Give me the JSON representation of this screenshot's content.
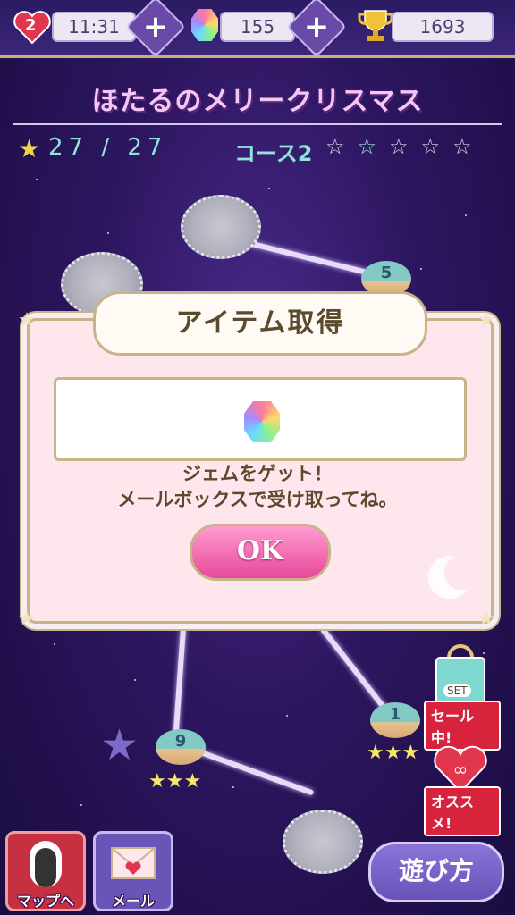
{
  "status": {
    "lives": "2",
    "time": "11:31",
    "gems": "155",
    "trophies": "1693"
  },
  "stage": {
    "title": "ほたるのメリークリスマス",
    "stars": "27 / 27",
    "course": "コース2"
  },
  "map_nodes": [
    "5",
    "1",
    "9"
  ],
  "dialog": {
    "title": "アイテム取得",
    "message_line1": "ジェムをゲット！",
    "message_line2": "メールボックスで受け取ってね。",
    "ok_label": "OK"
  },
  "side": {
    "sale_set": "SET",
    "sale_label": "セール中!",
    "recommend_label": "オススメ!"
  },
  "bottom": {
    "map_label": "マップへ",
    "mail_label": "メール",
    "howto_label": "遊び方"
  },
  "icons": [
    "heart-icon",
    "plus-icon",
    "gem-icon",
    "trophy-icon",
    "star-icon",
    "shooting-star-icon",
    "door-icon",
    "letter-icon",
    "shopping-bag-icon",
    "infinity-heart-icon",
    "moon-icon"
  ],
  "colors": {
    "accent": "#8fe5d9",
    "ok": "#e8489a",
    "dialog": "#fde6ec"
  }
}
